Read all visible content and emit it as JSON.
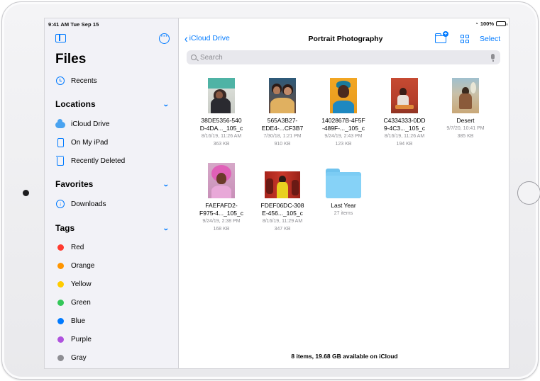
{
  "status": {
    "time_date": "9:41 AM  Tue Sep 15",
    "battery": "100%"
  },
  "sidebar": {
    "title": "Files",
    "recents": "Recents",
    "locations_header": "Locations",
    "locations": [
      {
        "label": "iCloud Drive",
        "icon": "icloud-icon"
      },
      {
        "label": "On My iPad",
        "icon": "ipad-icon"
      },
      {
        "label": "Recently Deleted",
        "icon": "trash-icon"
      }
    ],
    "favorites_header": "Favorites",
    "favorites": [
      {
        "label": "Downloads",
        "icon": "download-icon"
      }
    ],
    "tags_header": "Tags",
    "tags": [
      {
        "label": "Red",
        "color": "#ff3b30"
      },
      {
        "label": "Orange",
        "color": "#ff9500"
      },
      {
        "label": "Yellow",
        "color": "#ffcc00"
      },
      {
        "label": "Green",
        "color": "#34c759"
      },
      {
        "label": "Blue",
        "color": "#007aff"
      },
      {
        "label": "Purple",
        "color": "#af52de"
      },
      {
        "label": "Gray",
        "color": "#8e8e93"
      }
    ]
  },
  "nav": {
    "back_label": "iCloud Drive",
    "title": "Portrait Photography",
    "select_label": "Select"
  },
  "search": {
    "placeholder": "Search"
  },
  "items": [
    {
      "name1": "38DE5356-540",
      "name2": "D-4DA..._105_c",
      "date": "8/16/19, 11:26 AM",
      "size": "363 KB"
    },
    {
      "name1": "565A3B27-",
      "name2": "EDE4-...CF3B7",
      "date": "7/30/18, 1:21 PM",
      "size": "910 KB"
    },
    {
      "name1": "1402867B-4F5F",
      "name2": "-489F-..._105_c",
      "date": "9/24/19, 2:43 PM",
      "size": "123 KB"
    },
    {
      "name1": "C4334333-0DD",
      "name2": "9-4C3..._105_c",
      "date": "8/16/19, 11:26 AM",
      "size": "194 KB"
    },
    {
      "name1": "Desert",
      "name2": "",
      "date": "9/7/20, 10:41 PM",
      "size": "385 KB"
    },
    {
      "name1": "FAEFAFD2-",
      "name2": "F975-4..._105_c",
      "date": "9/24/19, 2:38 PM",
      "size": "168 KB"
    },
    {
      "name1": "FDEF06DC-308",
      "name2": "E-456..._105_c",
      "date": "8/16/19, 11:29 AM",
      "size": "347 KB"
    }
  ],
  "folder": {
    "name": "Last Year",
    "count": "27 items"
  },
  "footer": "8 items, 19.68 GB available on iCloud",
  "accent": "#007aff"
}
